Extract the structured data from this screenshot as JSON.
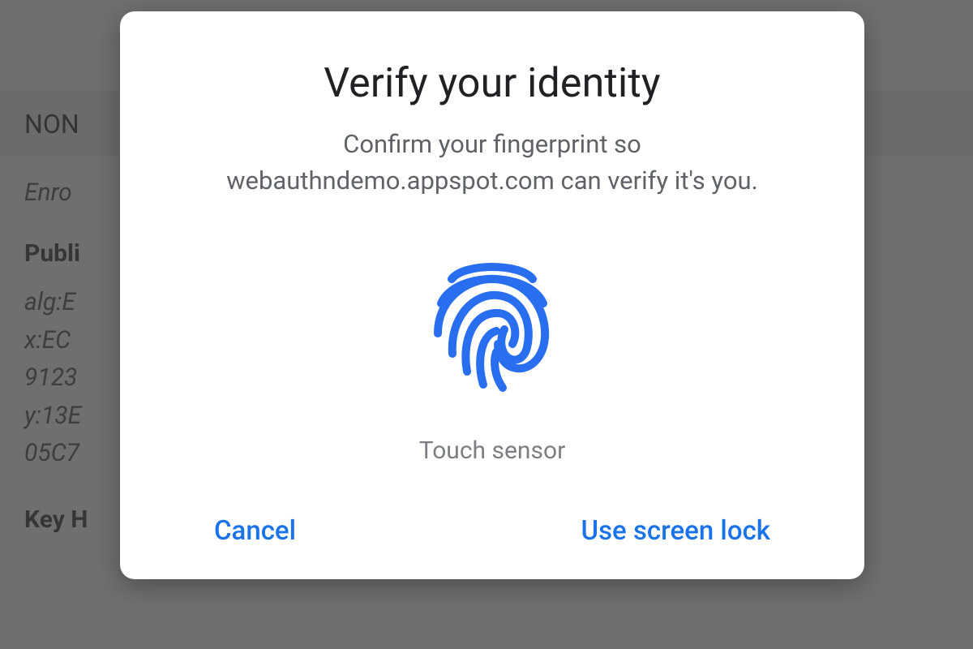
{
  "background": {
    "header": "NON",
    "enroll": "Enro",
    "public_label": "Publi",
    "alg_line": "alg:E",
    "x_line": "x:EC",
    "num_line": "9123",
    "y_line": "y:13E",
    "code_line": "05C7",
    "key_handle": "Key H"
  },
  "dialog": {
    "title": "Verify your identity",
    "body": "Confirm your fingerprint so webauthndemo.appspot.com can verify it's you.",
    "sensor_label": "Touch sensor",
    "actions": {
      "cancel": "Cancel",
      "alt": "Use screen lock"
    }
  },
  "colors": {
    "accent": "#1a73e8",
    "fingerprint": "#2a6ef0"
  }
}
